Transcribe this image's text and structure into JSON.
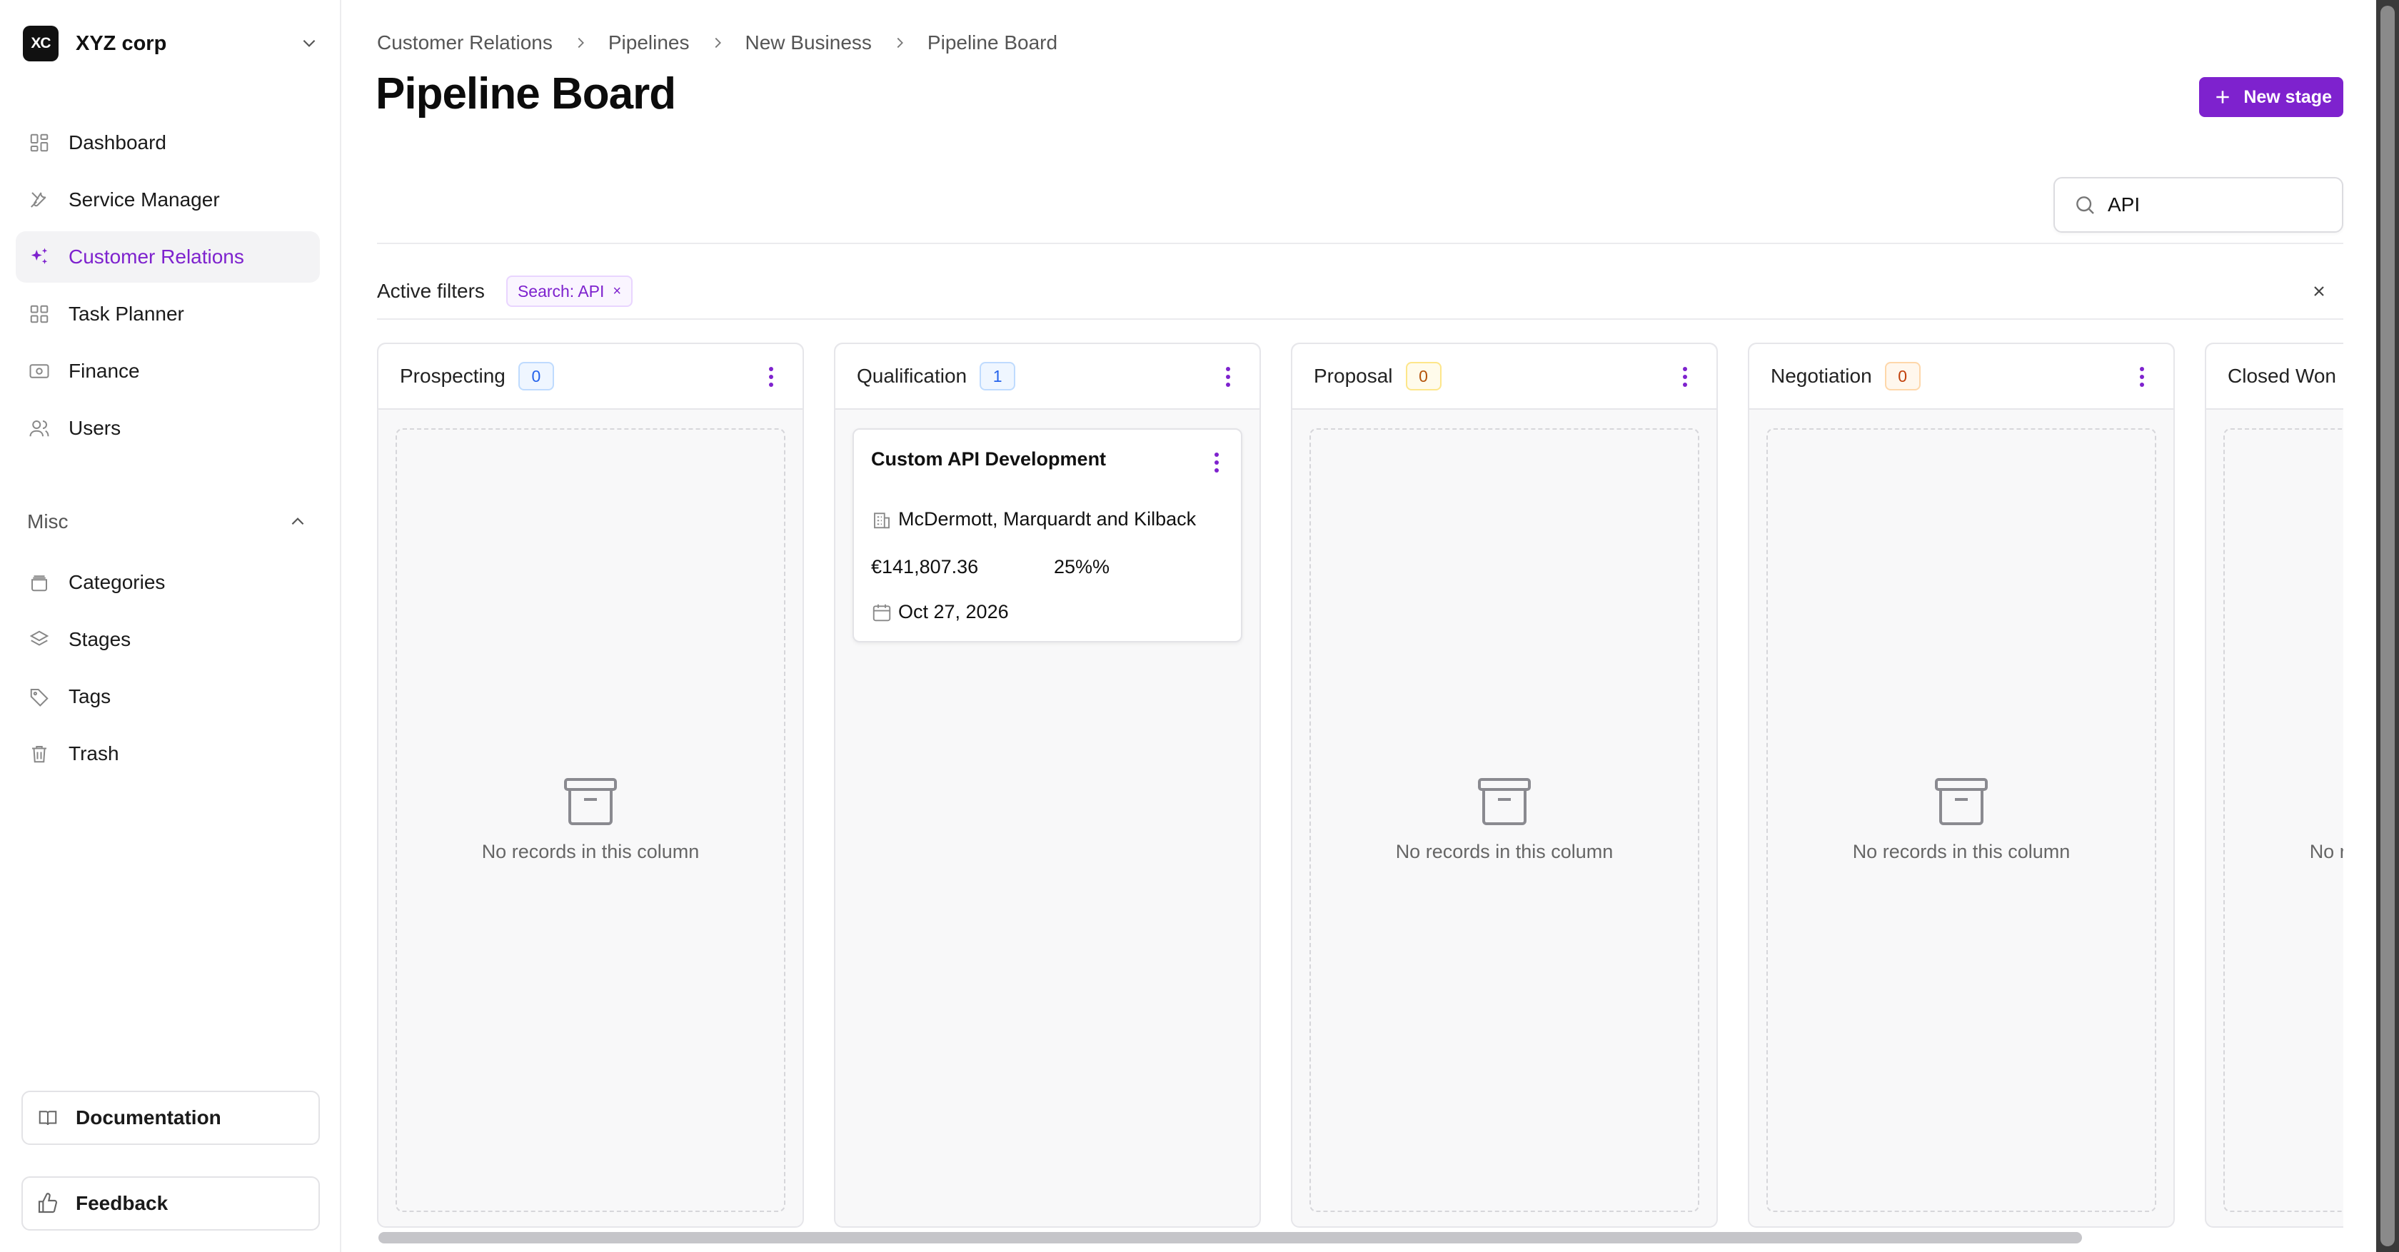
{
  "org": {
    "logo": "XC",
    "name": "XYZ corp"
  },
  "sidebar": {
    "items": [
      {
        "label": "Dashboard",
        "icon": "grid-icon",
        "active": false
      },
      {
        "label": "Service Manager",
        "icon": "tools-icon",
        "active": false
      },
      {
        "label": "Customer Relations",
        "icon": "sparkles-icon",
        "active": true
      },
      {
        "label": "Task Planner",
        "icon": "grid-icon",
        "active": false
      },
      {
        "label": "Finance",
        "icon": "banknote-icon",
        "active": false
      },
      {
        "label": "Users",
        "icon": "users-icon",
        "active": false
      }
    ],
    "misc_label": "Misc",
    "misc_items": [
      {
        "label": "Categories",
        "icon": "folder-icon"
      },
      {
        "label": "Stages",
        "icon": "layers-icon"
      },
      {
        "label": "Tags",
        "icon": "tag-icon"
      },
      {
        "label": "Trash",
        "icon": "trash-icon"
      }
    ],
    "documentation": "Documentation",
    "feedback": "Feedback"
  },
  "breadcrumb": [
    "Customer Relations",
    "Pipelines",
    "New Business",
    "Pipeline Board"
  ],
  "page_title": "Pipeline Board",
  "new_stage_label": "New stage",
  "search": {
    "value": "API"
  },
  "filters": {
    "label": "Active filters",
    "chip": "Search: API",
    "chip_remove": "×"
  },
  "empty_text": "No records in this column",
  "columns": [
    {
      "title": "Prospecting",
      "count": "0",
      "badge": "blue"
    },
    {
      "title": "Qualification",
      "count": "1",
      "badge": "blue"
    },
    {
      "title": "Proposal",
      "count": "0",
      "badge": "amber"
    },
    {
      "title": "Negotiation",
      "count": "0",
      "badge": "orange"
    },
    {
      "title": "Closed Won",
      "count": "",
      "badge": "green"
    }
  ],
  "card": {
    "title": "Custom API Development",
    "company": "McDermott, Marquardt and Kilback",
    "amount": "€141,807.36",
    "probability": "25%%",
    "date": "Oct 27, 2026"
  },
  "colors": {
    "accent": "#7e22ce",
    "active_bg": "#f3f3f5",
    "badge_blue": "#2563eb",
    "badge_amber": "#b45309",
    "badge_orange": "#c2410c"
  }
}
